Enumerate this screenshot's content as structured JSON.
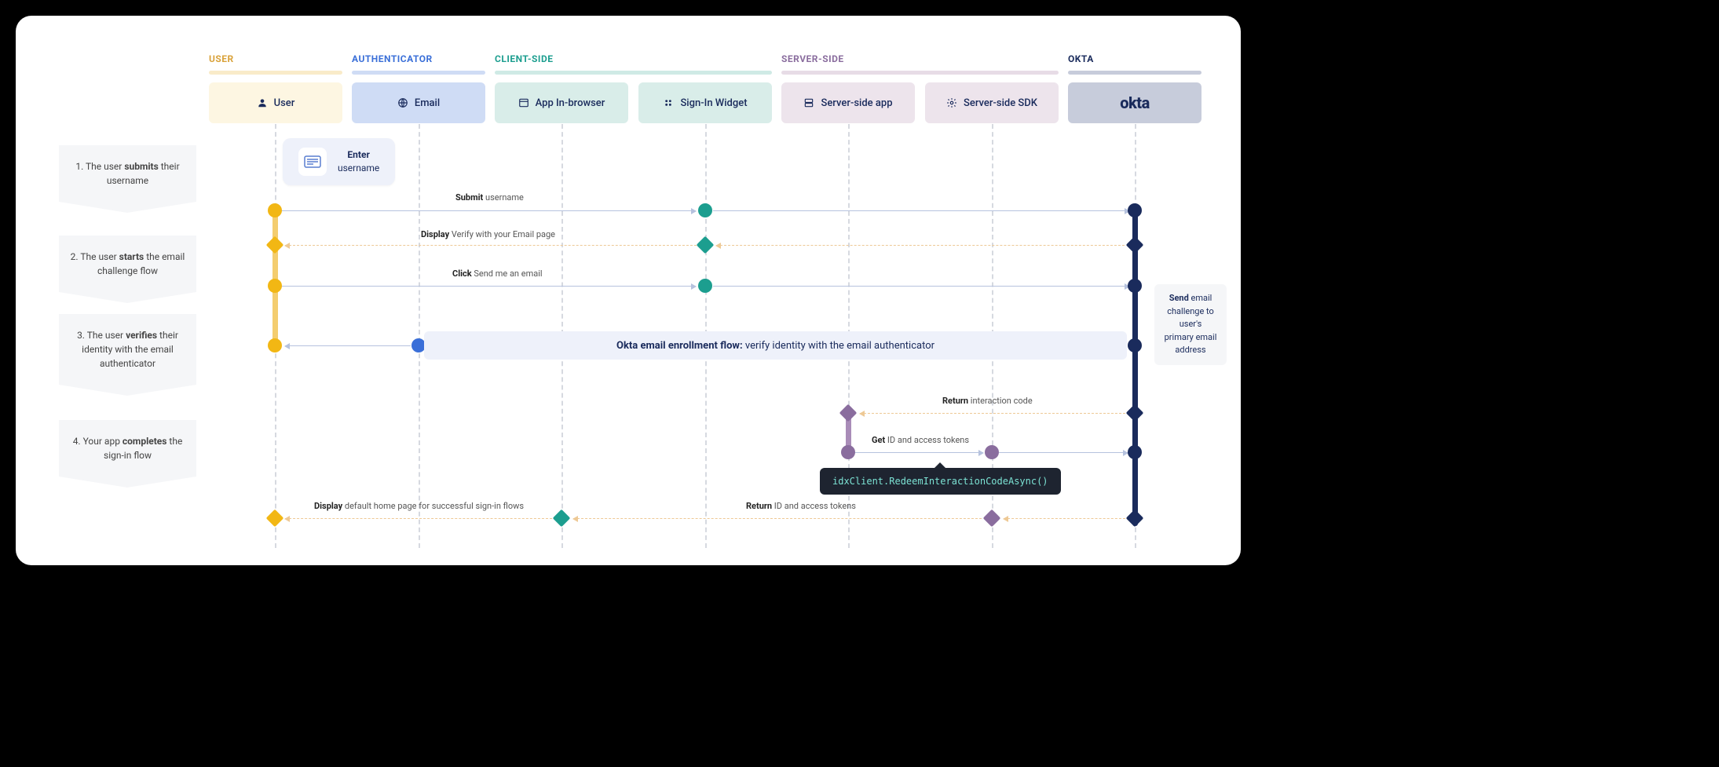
{
  "columns": {
    "user": {
      "label": "USER",
      "color": "#d9a23a"
    },
    "auth": {
      "label": "AUTHENTICATOR",
      "color": "#3a6fd8"
    },
    "client": {
      "label": "CLIENT-SIDE",
      "color": "#1c9e8f"
    },
    "server": {
      "label": "SERVER-SIDE",
      "color": "#8a6d9e"
    },
    "okta": {
      "label": "OKTA",
      "color": "#1a2b5c"
    }
  },
  "lanes": {
    "user": "User",
    "email": "Email",
    "browser": "App In-browser",
    "widget": "Sign-In Widget",
    "app": "Server-side app",
    "sdk": "Server-side SDK",
    "okta": "okta"
  },
  "steps": {
    "s1": {
      "num": "1.",
      "pre": "The user ",
      "bold": "submits",
      "post": " their username"
    },
    "s2": {
      "num": "2.",
      "pre": "The user ",
      "bold": "starts",
      "post": " the email challenge flow"
    },
    "s3": {
      "num": "3.",
      "pre": "The user ",
      "bold": "verifies",
      "post": " their identity with the email authenticator"
    },
    "s4": {
      "num": "4.",
      "pre": "Your app ",
      "bold": "completes",
      "post": " the sign-in flow"
    }
  },
  "card": {
    "bold": "Enter",
    "text": "username"
  },
  "arrows": {
    "a1": {
      "bold": "Submit",
      "text": " username"
    },
    "a2": {
      "bold": "Display",
      "text": " Verify with your Email page"
    },
    "a3": {
      "bold": "Click",
      "text": " Send me an email"
    },
    "a4": {
      "bold": "Return",
      "text": " interaction code"
    },
    "a5": {
      "bold": "Get",
      "text": " ID and access tokens"
    },
    "a6": {
      "bold": "Return",
      "text": " ID and access tokens"
    },
    "a7": {
      "bold": "Display",
      "text": " default home page for successful sign-in flows"
    }
  },
  "flow": {
    "bold": "Okta email enrollment flow:",
    "text": "  verify identity with the email authenticator"
  },
  "note": {
    "bold": "Send",
    "text": " email challenge to user's primary email address"
  },
  "tooltip": "idxClient.RedeemInteractionCodeAsync()"
}
